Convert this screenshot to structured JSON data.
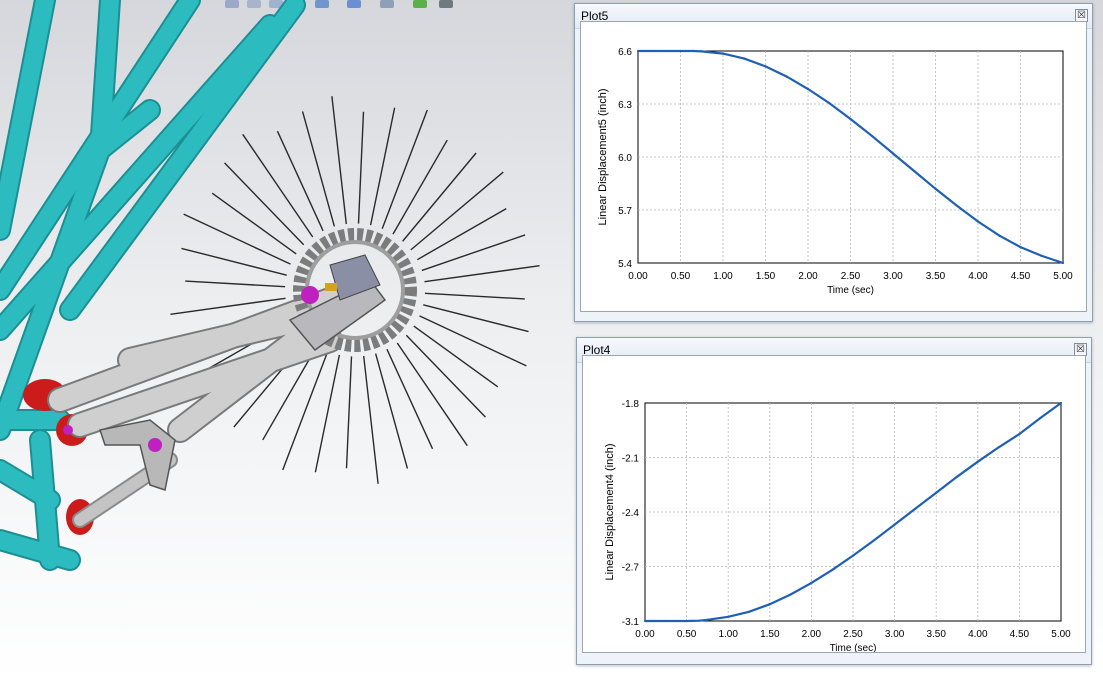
{
  "viewport": {
    "colors": {
      "frame": "#2cbcc0",
      "frame_dark": "#1b8f93",
      "mount": "#cc1b1b",
      "metal": "#c8c8c8",
      "accent": "#c020c0"
    }
  },
  "toolbar": {
    "icons": [
      "arrow-icon",
      "zoom-icon",
      "rotate-icon",
      "view-cube-icon",
      "display-style-icon",
      "appearance-icon",
      "scene-icon",
      "render-icon"
    ]
  },
  "plots": [
    {
      "title": "Plot5",
      "close_glyph": "☒",
      "chart_data": {
        "type": "line",
        "title": "",
        "xlabel": "Time (sec)",
        "ylabel": "Linear Displacement5 (inch)",
        "xlim": [
          0,
          5
        ],
        "ylim": [
          5.4,
          6.6
        ],
        "xticks": [
          "0.00",
          "0.50",
          "1.00",
          "1.50",
          "2.00",
          "2.50",
          "3.00",
          "3.50",
          "4.00",
          "4.50",
          "5.00"
        ],
        "yticks": [
          "6.6",
          "6.3",
          "6.0",
          "5.7",
          "5.4"
        ],
        "grid": true,
        "series": [
          {
            "color": "#1f5fb4",
            "x": [
              0,
              0.25,
              0.5,
              0.65,
              0.75,
              1.0,
              1.25,
              1.5,
              1.75,
              2.0,
              2.25,
              2.5,
              2.75,
              3.0,
              3.25,
              3.5,
              3.75,
              4.0,
              4.25,
              4.5,
              4.75,
              5.0
            ],
            "y": [
              6.6,
              6.6,
              6.6,
              6.6,
              6.598,
              6.585,
              6.557,
              6.513,
              6.455,
              6.385,
              6.305,
              6.215,
              6.12,
              6.02,
              5.92,
              5.82,
              5.725,
              5.635,
              5.555,
              5.49,
              5.44,
              5.4
            ]
          }
        ]
      }
    },
    {
      "title": "Plot4",
      "close_glyph": "☒",
      "chart_data": {
        "type": "line",
        "title": "",
        "xlabel": "Time (sec)",
        "ylabel": "Linear Displacement4 (inch)",
        "xlim": [
          0,
          5
        ],
        "ylim": [
          -3.1,
          -1.8
        ],
        "xticks": [
          "0.00",
          "0.50",
          "1.00",
          "1.50",
          "2.00",
          "2.50",
          "3.00",
          "3.50",
          "4.00",
          "4.50",
          "5.00"
        ],
        "yticks": [
          "-1.8",
          "-2.1",
          "-2.4",
          "-2.7",
          "-3.1"
        ],
        "grid": true,
        "series": [
          {
            "color": "#1f5fb4",
            "x": [
              0,
              0.25,
              0.5,
              0.65,
              0.75,
              1.0,
              1.25,
              1.5,
              1.75,
              2.0,
              2.25,
              2.5,
              2.75,
              3.0,
              3.25,
              3.5,
              3.75,
              4.0,
              4.25,
              4.5,
              4.75,
              5.0
            ],
            "y": [
              -3.1,
              -3.1,
              -3.1,
              -3.098,
              -3.093,
              -3.075,
              -3.045,
              -3.0,
              -2.942,
              -2.873,
              -2.795,
              -2.71,
              -2.62,
              -2.525,
              -2.43,
              -2.335,
              -2.24,
              -2.15,
              -2.065,
              -1.985,
              -1.89,
              -1.8
            ]
          }
        ]
      }
    }
  ]
}
